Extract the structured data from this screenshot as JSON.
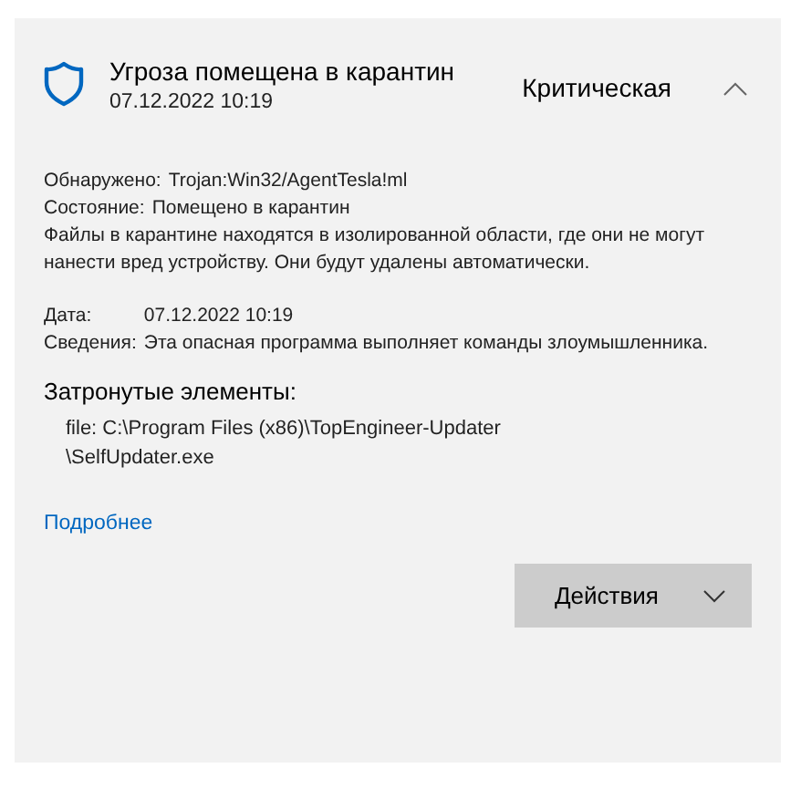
{
  "threat": {
    "title": "Угроза помещена в карантин",
    "date": "07.12.2022 10:19",
    "severity": "Критическая",
    "expanded": true
  },
  "status_lines": [
    {
      "label": "Обнаружено:",
      "value": "Trojan:Win32/AgentTesla!ml"
    },
    {
      "label": "Состояние:",
      "value": "Помещено в карантин"
    }
  ],
  "description": "Файлы в карантине находятся в изолированной области, где они не могут нанести вред устройству. Они будут удалены автоматически.",
  "info_lines": [
    {
      "label": "Дата:",
      "value": "07.12.2022 10:19"
    },
    {
      "label": "Сведения:",
      "value": "Эта опасная программа выполняет команды злоумышленника."
    }
  ],
  "affected": {
    "heading": "Затронутые элементы:",
    "items": [
      "file: C:\\Program Files (x86)\\TopEngineer-Updater \\SelfUpdater.exe"
    ]
  },
  "link": "Подробнее",
  "actions_button": "Действия"
}
